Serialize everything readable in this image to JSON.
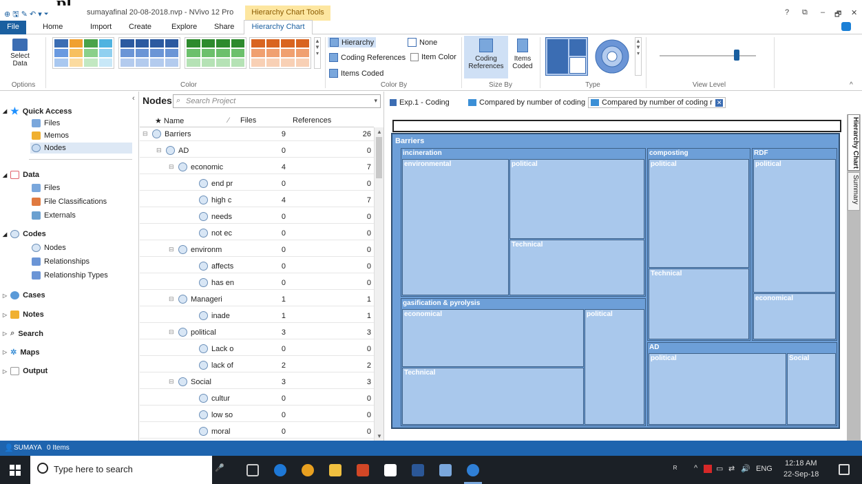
{
  "titlebar": {
    "qa_icons": "⊕ 🖫 ✎ ↶ ▾ ⏷",
    "title": "sumayafinal 20-08-2018.nvp - NVivo 12 Pro",
    "context_tab": "Hierarchy Chart Tools",
    "controls": [
      "?",
      "⧉",
      "–",
      "🗗",
      "✕"
    ]
  },
  "menubar": {
    "file": "File",
    "items": [
      "Home",
      "Import",
      "Create",
      "Explore",
      "Share"
    ],
    "active_tab": "Hierarchy Chart"
  },
  "ribbon": {
    "select_data": "Select\nData",
    "group_options": "Options",
    "group_color": "Color",
    "color_by": {
      "hierarchy": "Hierarchy",
      "none": "None",
      "coding_refs": "Coding References",
      "item_color": "Item Color",
      "items_coded": "Items Coded",
      "label": "Color By"
    },
    "size_by": {
      "coding_refs": "Coding\nReferences",
      "items_coded": "Items\nCoded",
      "label": "Size By"
    },
    "type_label": "Type",
    "view_level_label": "View Level",
    "slider_level": 0.82
  },
  "nav": {
    "quick_access": "Quick Access",
    "qa_items": [
      "Files",
      "Memos",
      "Nodes"
    ],
    "data": "Data",
    "data_items": [
      "Files",
      "File Classifications",
      "Externals"
    ],
    "codes": "Codes",
    "codes_items": [
      "Nodes",
      "Relationships",
      "Relationship Types"
    ],
    "cases": "Cases",
    "notes": "Notes",
    "search": "Search",
    "maps": "Maps",
    "output": "Output"
  },
  "nodes": {
    "title": "Nodes",
    "search_placeholder": "Search Project",
    "col_name": "Name",
    "col_files": "Files",
    "col_refs": "References",
    "rows": [
      {
        "name": "Barriers",
        "files": "9",
        "refs": "26",
        "level": 0
      },
      {
        "name": "AD",
        "files": "0",
        "refs": "0",
        "level": 1
      },
      {
        "name": "economic",
        "files": "4",
        "refs": "7",
        "level": 2
      },
      {
        "name": "end pr",
        "files": "0",
        "refs": "0",
        "level": 3
      },
      {
        "name": "high c",
        "files": "4",
        "refs": "7",
        "level": 3
      },
      {
        "name": "needs",
        "files": "0",
        "refs": "0",
        "level": 3
      },
      {
        "name": "not ec",
        "files": "0",
        "refs": "0",
        "level": 3
      },
      {
        "name": "environm",
        "files": "0",
        "refs": "0",
        "level": 2
      },
      {
        "name": "affects",
        "files": "0",
        "refs": "0",
        "level": 3
      },
      {
        "name": "has en",
        "files": "0",
        "refs": "0",
        "level": 3
      },
      {
        "name": "Manageri",
        "files": "1",
        "refs": "1",
        "level": 2
      },
      {
        "name": "inade",
        "files": "1",
        "refs": "1",
        "level": 3
      },
      {
        "name": "political",
        "files": "3",
        "refs": "3",
        "level": 2
      },
      {
        "name": "Lack o",
        "files": "0",
        "refs": "0",
        "level": 3
      },
      {
        "name": "lack of",
        "files": "2",
        "refs": "2",
        "level": 3
      },
      {
        "name": "Social",
        "files": "3",
        "refs": "3",
        "level": 2
      },
      {
        "name": "cultur",
        "files": "0",
        "refs": "0",
        "level": 3
      },
      {
        "name": "low so",
        "files": "0",
        "refs": "0",
        "level": 3
      },
      {
        "name": "moral",
        "files": "0",
        "refs": "0",
        "level": 3
      }
    ]
  },
  "tabs": {
    "t1": "Exp.1 - Coding",
    "t2": "Compared by number of coding",
    "t3": "Compared by number of coding r"
  },
  "side_tabs": {
    "a": "Hierarchy Chart",
    "b": "Summary"
  },
  "treemap": {
    "root": "Barriers",
    "incineration": "incineration",
    "environmental": "environmental",
    "political": "political",
    "technical": "Technical",
    "composting": "composting",
    "rdf": "RDF",
    "economical": "economical",
    "gasification": "gasification & pyrolysis",
    "ad": "AD",
    "social": "Social"
  },
  "status": {
    "user": "SUMAYA",
    "items": "0 Items"
  },
  "taskbar": {
    "search_placeholder": "Type here to search",
    "time": "12:18 AM",
    "date": "22-Sep-18",
    "lang": "ENG"
  }
}
